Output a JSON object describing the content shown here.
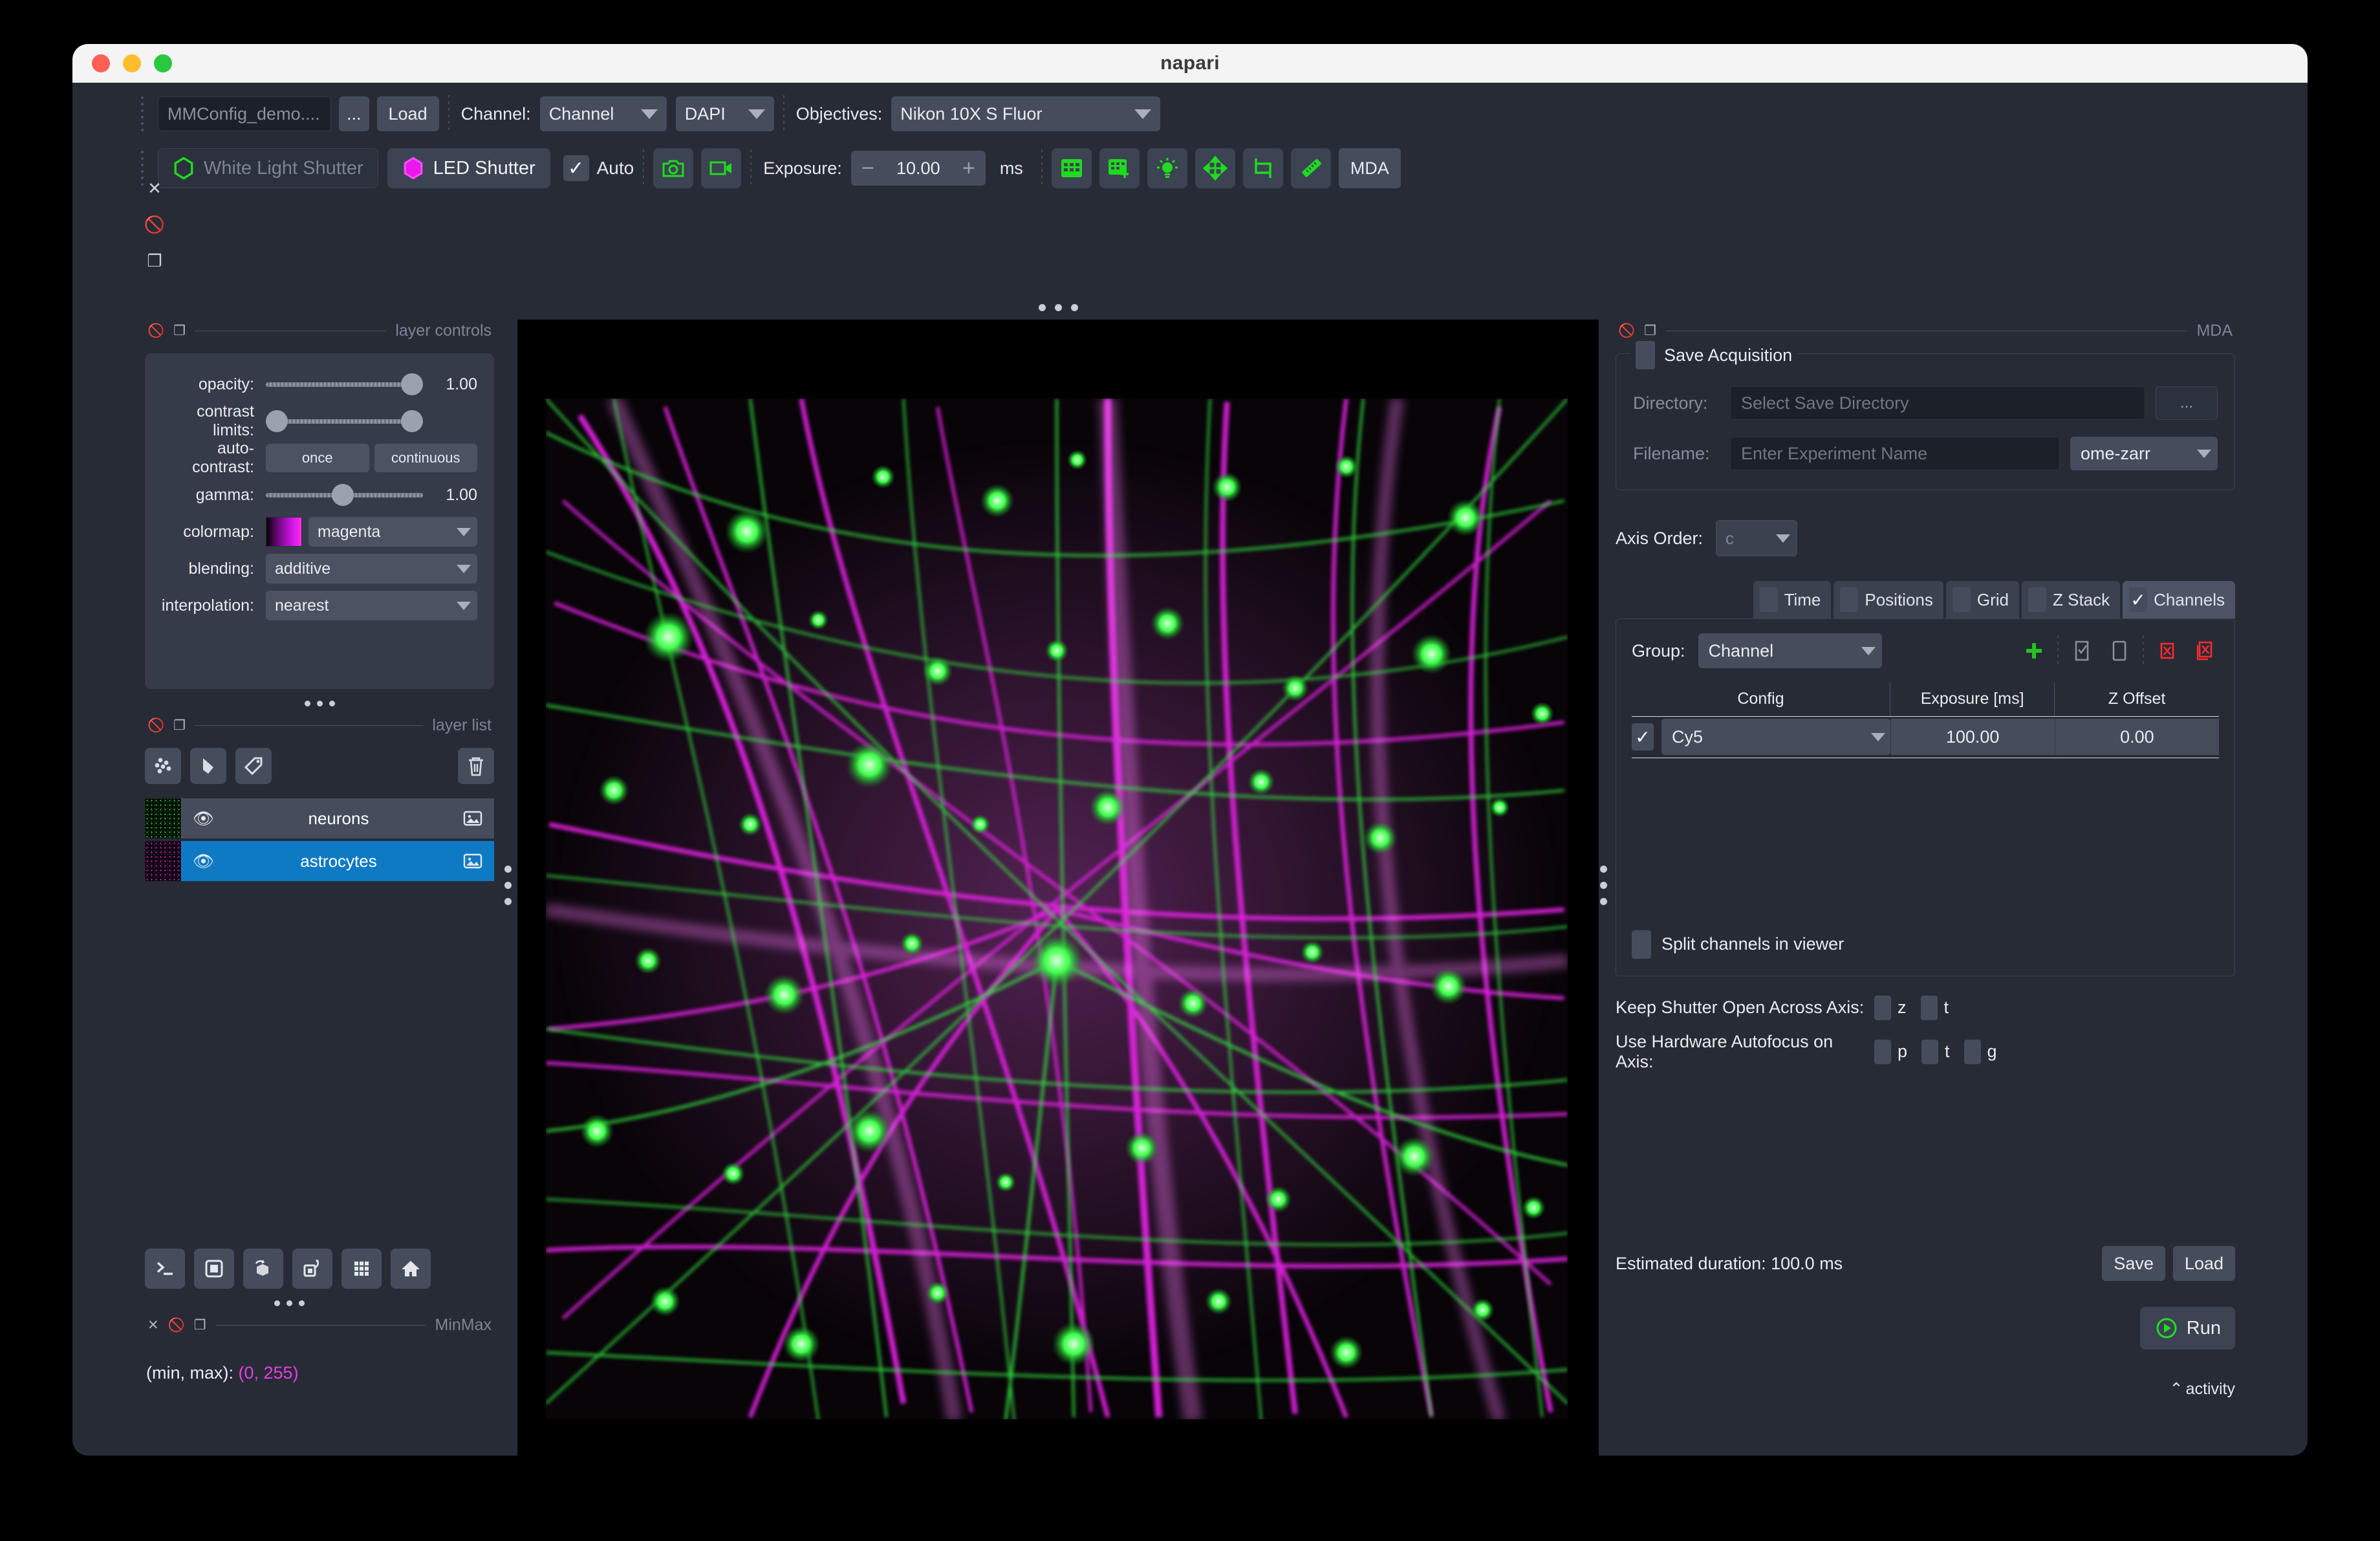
{
  "window": {
    "title": "napari"
  },
  "mm_toolbar": {
    "config_file": "MMConfig_demo....",
    "browse_label": "...",
    "load_label": "Load",
    "channel_label": "Channel:",
    "channel_group_value": "Channel",
    "channel_preset_value": "DAPI",
    "objectives_label": "Objectives:",
    "objectives_value": "Nikon 10X S Fluor",
    "white_light_shutter": "White Light Shutter",
    "led_shutter": "LED Shutter",
    "auto_label": "Auto",
    "exposure_label": "Exposure:",
    "exposure_value": "10.00",
    "exposure_units": "ms",
    "mda_label": "MDA",
    "icons": {
      "snap": "camera-icon",
      "live": "video-camera-icon",
      "groups_presets": "grid-icon",
      "group_preset_add": "grid-plus-icon",
      "illumination": "lightbulb-icon",
      "stage_control": "move-arrows-icon",
      "camera_roi": "crop-icon",
      "pixel_size": "ruler-icon"
    }
  },
  "left_dock": {
    "rail_icons": [
      "close-icon",
      "hide-icon",
      "float-icon"
    ],
    "layer_controls": {
      "title": "layer controls",
      "opacity_label": "opacity:",
      "opacity_value": "1.00",
      "contrast_label": "contrast limits:",
      "autocontrast_label": "auto-contrast:",
      "autocontrast_once": "once",
      "autocontrast_continuous": "continuous",
      "gamma_label": "gamma:",
      "gamma_value": "1.00",
      "colormap_label": "colormap:",
      "colormap_value": "magenta",
      "blending_label": "blending:",
      "blending_value": "additive",
      "interpolation_label": "interpolation:",
      "interpolation_value": "nearest"
    },
    "layer_list": {
      "title": "layer list",
      "buttons": [
        "new-points-icon",
        "new-shapes-icon",
        "new-labels-icon",
        "delete-layer-icon"
      ],
      "layers": [
        {
          "name": "neurons",
          "selected": false,
          "color": "#22cc33"
        },
        {
          "name": "astrocytes",
          "selected": true,
          "color": "#cc22cc"
        }
      ]
    },
    "viewer_buttons": [
      "console-icon",
      "ndisplay-2d-icon",
      "roll-dims-icon",
      "transpose-dims-icon",
      "grid-view-icon",
      "home-icon"
    ],
    "minmax": {
      "title": "MinMax",
      "label": "(min, max):",
      "value": "(0, 255)",
      "value_color": "#e83ee8"
    }
  },
  "right_dock": {
    "title": "MDA",
    "save_acquisition": {
      "legend": "Save Acquisition",
      "checked": false,
      "directory_label": "Directory:",
      "directory_placeholder": "Select Save Directory",
      "browse_label": "...",
      "filename_label": "Filename:",
      "filename_placeholder": "Enter Experiment Name",
      "format_value": "ome-zarr"
    },
    "axis_order": {
      "label": "Axis Order:",
      "value": "c"
    },
    "tabs": [
      {
        "label": "Time",
        "checked": false,
        "active": false
      },
      {
        "label": "Positions",
        "checked": false,
        "active": false
      },
      {
        "label": "Grid",
        "checked": false,
        "active": false
      },
      {
        "label": "Z Stack",
        "checked": false,
        "active": false
      },
      {
        "label": "Channels",
        "checked": true,
        "active": true
      }
    ],
    "channels": {
      "group_label": "Group:",
      "group_value": "Channel",
      "actions": [
        "add-channel-icon",
        "select-all-icon",
        "duplicate-icon",
        "remove-icon",
        "clear-all-icon"
      ],
      "action_colors": {
        "add": "#22c422",
        "remove": "#ff2b2b"
      },
      "columns": [
        "Config",
        "Exposure [ms]",
        "Z Offset"
      ],
      "rows": [
        {
          "checked": true,
          "config": "Cy5",
          "exposure": "100.00",
          "z_offset": "0.00"
        }
      ],
      "split_label": "Split channels in viewer",
      "split_checked": false
    },
    "keep_shutter": {
      "label": "Keep Shutter Open Across Axis:",
      "options": [
        "z",
        "t"
      ]
    },
    "autofocus": {
      "label": "Use Hardware Autofocus on Axis:",
      "options": [
        "p",
        "t",
        "g"
      ]
    },
    "footer": {
      "estimated": "Estimated duration: 100.0 ms",
      "save_label": "Save",
      "load_label": "Load",
      "run_label": "Run",
      "activity_label": "activity"
    }
  }
}
